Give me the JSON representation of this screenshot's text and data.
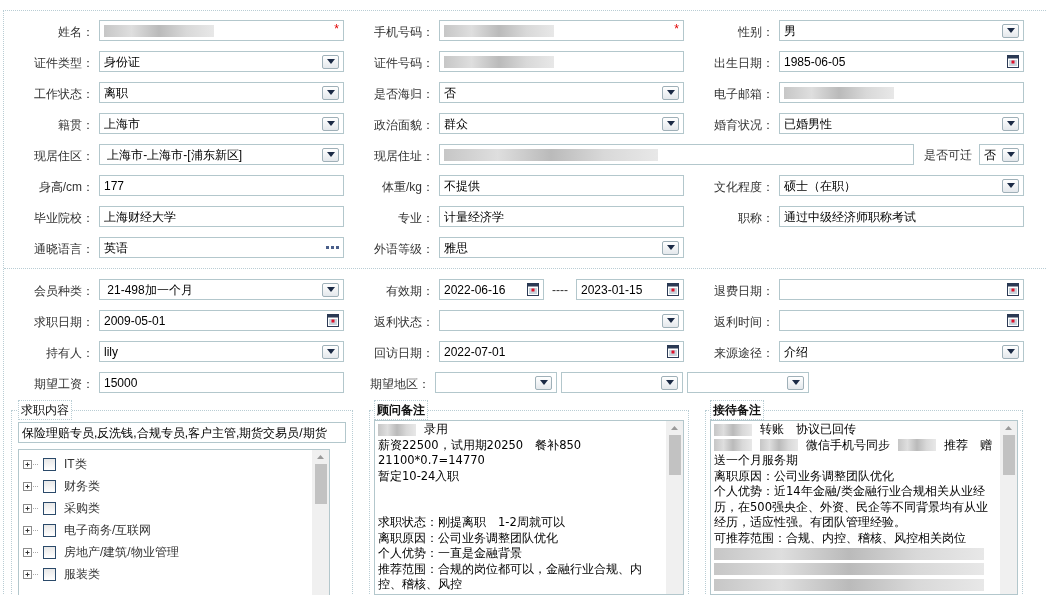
{
  "section1": {
    "rows": [
      [
        {
          "label": "姓名：",
          "kind": "text",
          "redacted": true,
          "required_mark": "*"
        },
        {
          "label": "手机号码：",
          "kind": "text",
          "redacted": true,
          "required_mark": "*"
        },
        {
          "label": "性别：",
          "kind": "select",
          "value": "男"
        }
      ],
      [
        {
          "label": "证件类型：",
          "kind": "select",
          "value": "身份证"
        },
        {
          "label": "证件号码：",
          "kind": "text",
          "redacted": true
        },
        {
          "label": "出生日期：",
          "kind": "date",
          "value": "1985-06-05"
        }
      ],
      [
        {
          "label": "工作状态：",
          "kind": "select",
          "value": "离职"
        },
        {
          "label": "是否海归：",
          "kind": "select",
          "value": "否"
        },
        {
          "label": "电子邮箱：",
          "kind": "text",
          "redacted": true
        }
      ],
      [
        {
          "label": "籍贯：",
          "kind": "select",
          "value": "上海市"
        },
        {
          "label": "政治面貌：",
          "kind": "select",
          "value": "群众"
        },
        {
          "label": "婚育状况：",
          "kind": "select",
          "value": "已婚男性"
        }
      ],
      [
        {
          "label": "现居住区：",
          "kind": "select",
          "value": " 上海市-上海市-[浦东新区]"
        },
        {
          "label": "现居住址：",
          "kind": "wide_text",
          "redacted": true,
          "attachment": {
            "label": "是否可迁",
            "value": "否"
          }
        }
      ],
      [
        {
          "label": "身高/cm：",
          "kind": "text",
          "value": "177"
        },
        {
          "label": "体重/kg：",
          "kind": "text",
          "value": "不提供"
        },
        {
          "label": "文化程度：",
          "kind": "select",
          "value": "硕士（在职）"
        }
      ],
      [
        {
          "label": "毕业院校：",
          "kind": "text",
          "value": "上海财经大学"
        },
        {
          "label": "专业：",
          "kind": "text",
          "value": "计量经济学"
        },
        {
          "label": "职称：",
          "kind": "text",
          "value": "通过中级经济师职称考试"
        }
      ],
      [
        {
          "label": "通晓语言：",
          "kind": "more",
          "value": "英语"
        },
        {
          "label": "外语等级：",
          "kind": "select",
          "value": "雅思"
        }
      ]
    ]
  },
  "section2": {
    "rows": [
      [
        {
          "label": "会员种类：",
          "kind": "select",
          "value": " 21-498加一个月"
        },
        {
          "label": "有效期：",
          "kind": "date_range",
          "value": "2022-06-16",
          "separator": "----",
          "value_to": "2023-01-15"
        },
        {
          "label": "退费日期：",
          "kind": "date"
        }
      ],
      [
        {
          "label": "求职日期：",
          "kind": "date",
          "value": "2009-05-01"
        },
        {
          "label": "返利状态：",
          "kind": "select"
        },
        {
          "label": "返利时间：",
          "kind": "date"
        }
      ],
      [
        {
          "label": "持有人：",
          "kind": "select",
          "value": "lily"
        },
        {
          "label": "回访日期：",
          "kind": "date",
          "value": "2022-07-01"
        },
        {
          "label": "来源途径：",
          "kind": "select",
          "value": "介绍"
        }
      ],
      [
        {
          "label": "期望工资：",
          "kind": "text",
          "value": "15000"
        },
        {
          "label": "期望地区：",
          "kind": "select_group",
          "selects": [
            {
              "kind": "select"
            },
            {
              "kind": "select"
            },
            {
              "kind": "select"
            }
          ]
        }
      ]
    ]
  },
  "job_panel": {
    "legend": "求职内容",
    "search_value": "保险理赔专员,反洗钱,合规专员,客户主管,期货交易员/期货",
    "tree": [
      {
        "label": "IT类",
        "expanded": false,
        "checked": false
      },
      {
        "label": "财务类",
        "expanded": false,
        "checked": false
      },
      {
        "label": "采购类",
        "expanded": false,
        "checked": false
      },
      {
        "label": "电子商务/互联网",
        "expanded": false,
        "checked": false
      },
      {
        "label": "房地产/建筑/物业管理",
        "expanded": false,
        "checked": false
      },
      {
        "label": "服装类",
        "expanded": false,
        "checked": false
      }
    ]
  },
  "advisor_notes": {
    "legend": "顾问备注",
    "lines": [
      [
        {
          "kind": "blurred"
        },
        {
          "kind": "text",
          "text": "录用"
        }
      ],
      [
        {
          "kind": "text",
          "text": "薪资22500，试用期20250　餐补850"
        }
      ],
      [
        {
          "kind": "text",
          "text": "21100*0.7=14770"
        }
      ],
      [
        {
          "kind": "text",
          "text": "暂定10-24入职"
        }
      ],
      [
        {
          "kind": "blank"
        }
      ],
      [
        {
          "kind": "blank"
        }
      ],
      [
        {
          "kind": "text",
          "text": "求职状态：刚提离职　1-2周就可以"
        }
      ],
      [
        {
          "kind": "text",
          "text": "离职原因：公司业务调整团队优化"
        }
      ],
      [
        {
          "kind": "text",
          "text": "个人优势：一直是金融背景"
        }
      ],
      [
        {
          "kind": "text",
          "text": "推荐范围：合规的岗位都可以，金融行业合规、内"
        }
      ],
      [
        {
          "kind": "text",
          "text": "控、稽核、风控"
        }
      ]
    ]
  },
  "reception_notes": {
    "legend": "接待备注",
    "lines": [
      [
        {
          "kind": "blurred"
        },
        {
          "kind": "text",
          "text": "转账　协议已回传"
        }
      ],
      [
        {
          "kind": "blurred"
        },
        {
          "kind": "blurred"
        },
        {
          "kind": "text",
          "text": "微信手机号同步"
        },
        {
          "kind": "blurred"
        },
        {
          "kind": "text",
          "text": "推荐　赠"
        }
      ],
      [
        {
          "kind": "text",
          "text": "送一个月服务期"
        }
      ],
      [
        {
          "kind": "text",
          "text": "离职原因：公司业务调整团队优化"
        }
      ],
      [
        {
          "kind": "text",
          "text": "个人优势：近14年金融/类金融行业合规相关从业经"
        }
      ],
      [
        {
          "kind": "text",
          "text": "历，在500强央企、外资、民企等不同背景均有从业"
        }
      ],
      [
        {
          "kind": "text",
          "text": "经历，适应性强。有团队管理经验。"
        }
      ],
      [
        {
          "kind": "text",
          "text": "可推荐范围：合规、内控、稽核、风控相关岗位"
        }
      ],
      [
        {
          "kind": "blurred_line"
        }
      ],
      [
        {
          "kind": "blurred_line"
        }
      ],
      [
        {
          "kind": "blurred_line"
        }
      ]
    ]
  }
}
